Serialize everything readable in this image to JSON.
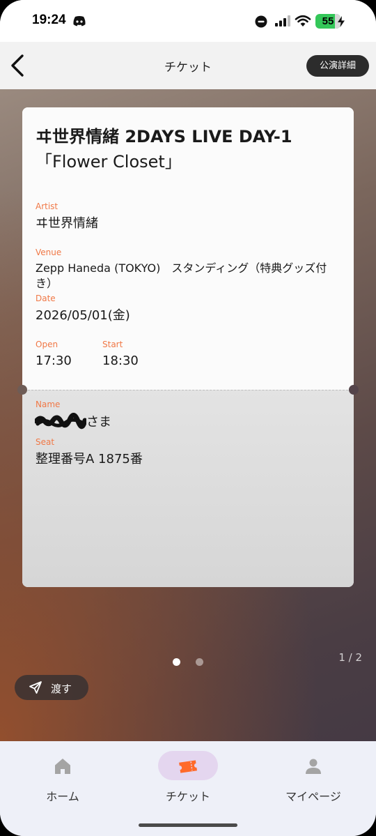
{
  "status_bar": {
    "time": "19:24",
    "battery_level": "55",
    "icons": [
      "discord-icon",
      "do-not-disturb-icon",
      "signal-icon",
      "wifi-icon",
      "charging-icon"
    ]
  },
  "header": {
    "title": "チケット",
    "details_button_label": "公演詳細",
    "back_icon": "chevron-left-icon"
  },
  "ticket": {
    "title_line1": "ヰ世界情緒 2DAYS LIVE DAY-1",
    "title_line2": "「Flower Closet」",
    "artist_label": "Artist",
    "artist": "ヰ世界情緒",
    "venue_label": "Venue",
    "venue_line1": "Zepp Haneda (TOKYO)　スタンディング（特典グッズ付",
    "venue_line2": "き）",
    "date_label": "Date",
    "date": "2026/05/01(金)",
    "open_label": "Open",
    "open": "17:30",
    "start_label": "Start",
    "start": "18:30",
    "name_label": "Name",
    "name_suffix": "さま",
    "seat_label": "Seat",
    "seat": "整理番号A 1875番"
  },
  "pager": {
    "indicator": "1 / 2",
    "current_page": 1,
    "total_pages": 2
  },
  "transfer_button": {
    "label": "渡す",
    "icon": "send-icon"
  },
  "bottom_nav": {
    "items": [
      {
        "label": "ホーム",
        "icon": "home-icon",
        "active": false
      },
      {
        "label": "チケット",
        "icon": "ticket-icon",
        "active": true
      },
      {
        "label": "マイページ",
        "icon": "person-icon",
        "active": false
      }
    ]
  },
  "colors": {
    "accent_label": "#f07846",
    "active_tab_pill": "#e4d6ef",
    "ticket_icon": "#ff6a2a"
  }
}
